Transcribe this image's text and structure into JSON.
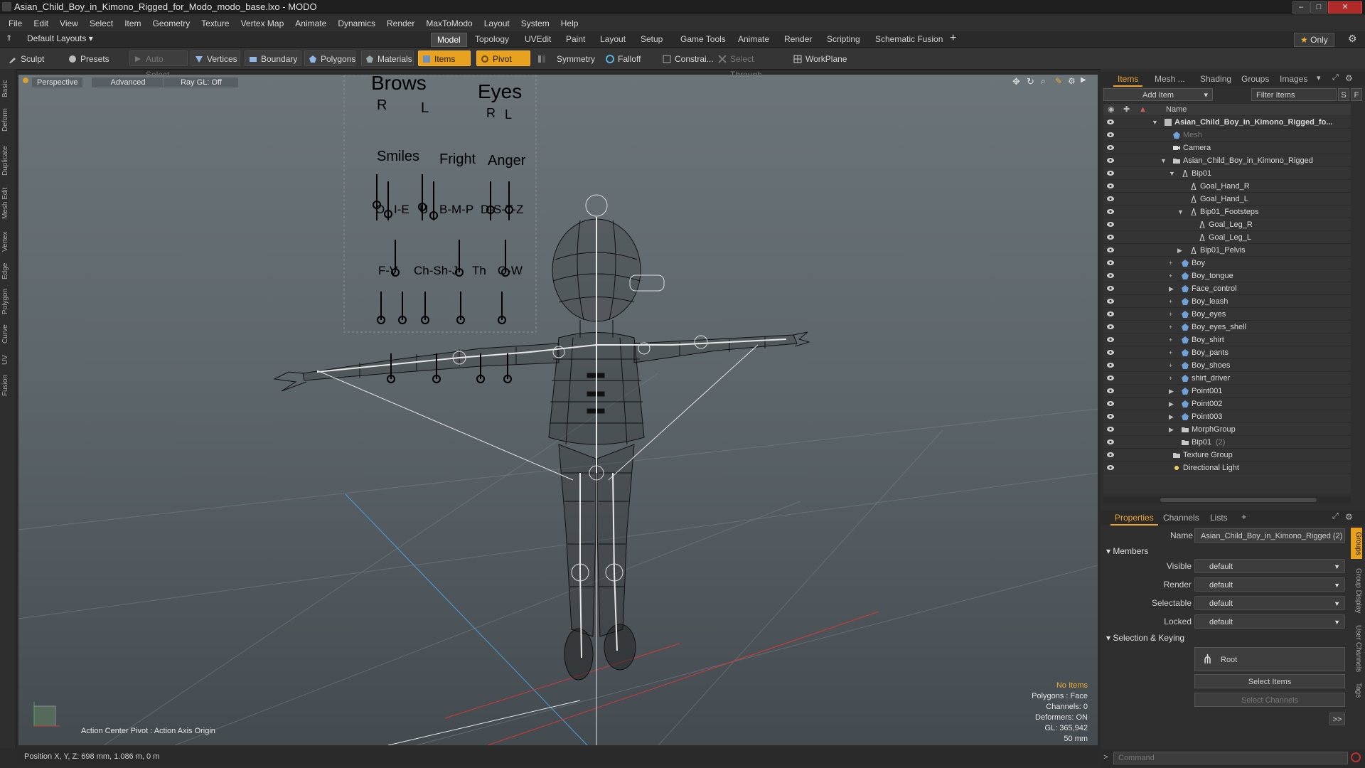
{
  "window": {
    "title": "Asian_Child_Boy_in_Kimono_Rigged_for_Modo_modo_base.lxo - MODO"
  },
  "menu": [
    "File",
    "Edit",
    "View",
    "Select",
    "Item",
    "Geometry",
    "Texture",
    "Vertex Map",
    "Animate",
    "Dynamics",
    "Render",
    "MaxToModo",
    "Layout",
    "System",
    "Help"
  ],
  "layout": {
    "preset": "Default Layouts",
    "tabs": [
      "Model",
      "Topology",
      "UVEdit",
      "Paint",
      "Layout",
      "Setup",
      "Game Tools",
      "Animate",
      "Render",
      "Scripting",
      "Schematic Fusion"
    ],
    "active_tab": "Model",
    "only_label": "Only"
  },
  "toolbar": {
    "sculpt": "Sculpt",
    "presets": "Presets",
    "auto_select": "Auto Select",
    "vertices": "Vertices",
    "boundary": "Boundary",
    "polygons": "Polygons",
    "materials": "Materials",
    "items": "Items",
    "pivot": "Pivot",
    "symmetry": "Symmetry",
    "falloff": "Falloff",
    "constraints": "Constrai...",
    "select_through": "Select Through",
    "workplane": "WorkPlane"
  },
  "left_tabs": [
    "Basic",
    "Deform",
    "Duplicate",
    "Mesh Edit",
    "Vertex",
    "Edge",
    "Polygon",
    "Curve",
    "UV",
    "Fusion"
  ],
  "viewport": {
    "perspective": "Perspective",
    "advanced": "Advanced",
    "raygl": "Ray GL: Off",
    "action_center": "Action Center Pivot : Action Axis Origin",
    "hud": {
      "no_items": "No Items",
      "polygons": "Polygons : Face",
      "channels": "Channels: 0",
      "deformers": "Deformers: ON",
      "gl": "GL: 365,942",
      "scale": "50 mm"
    },
    "face_board": {
      "brows": "Brows",
      "eyes": "Eyes",
      "r1": "R",
      "l1": "L",
      "r2": "R",
      "l2": "L",
      "smiles": "Smiles",
      "fright": "Fright",
      "anger": "Anger",
      "o": "O",
      "ie": "I-E",
      "u": "U",
      "bmp": "B-M-P",
      "dstz": "D-S-T-Z",
      "fv": "F-V",
      "chshj": "Ch-Sh-J",
      "th": "Th",
      "qw": "Q-W"
    }
  },
  "status": {
    "position": "Position X, Y, Z:   698 mm, 1.086 m, 0 m"
  },
  "items_panel": {
    "tabs": [
      "Items",
      "Mesh ...",
      "Shading",
      "Groups",
      "Images"
    ],
    "add_item": "Add Item",
    "filter": "Filter Items",
    "s_btn": "S",
    "f_btn": "F",
    "name_col": "Name",
    "tree": [
      {
        "label": "Asian_Child_Boy_in_Kimono_Rigged_fo...",
        "indent": 0,
        "arrow": "▼",
        "icon": "scene",
        "bold": true
      },
      {
        "label": "Mesh",
        "indent": 1,
        "arrow": "",
        "icon": "mesh",
        "dim": true
      },
      {
        "label": "Camera",
        "indent": 1,
        "arrow": "",
        "icon": "camera"
      },
      {
        "label": "Asian_Child_Boy_in_Kimono_Rigged",
        "indent": 1,
        "arrow": "▼",
        "icon": "group"
      },
      {
        "label": "Bip01",
        "indent": 2,
        "arrow": "▼",
        "icon": "bone"
      },
      {
        "label": "Goal_Hand_R",
        "indent": 3,
        "arrow": "",
        "icon": "bone"
      },
      {
        "label": "Goal_Hand_L",
        "indent": 3,
        "arrow": "",
        "icon": "bone"
      },
      {
        "label": "Bip01_Footsteps",
        "indent": 3,
        "arrow": "▼",
        "icon": "bone"
      },
      {
        "label": "Goal_Leg_R",
        "indent": 4,
        "arrow": "",
        "icon": "bone"
      },
      {
        "label": "Goal_Leg_L",
        "indent": 4,
        "arrow": "",
        "icon": "bone"
      },
      {
        "label": "Bip01_Pelvis",
        "indent": 3,
        "arrow": "▶",
        "icon": "bone"
      },
      {
        "label": "Boy",
        "indent": 2,
        "arrow": "+",
        "icon": "mesh"
      },
      {
        "label": "Boy_tongue",
        "indent": 2,
        "arrow": "+",
        "icon": "mesh"
      },
      {
        "label": "Face_control",
        "indent": 2,
        "arrow": "▶",
        "icon": "mesh"
      },
      {
        "label": "Boy_leash",
        "indent": 2,
        "arrow": "+",
        "icon": "mesh"
      },
      {
        "label": "Boy_eyes",
        "indent": 2,
        "arrow": "+",
        "icon": "mesh"
      },
      {
        "label": "Boy_eyes_shell",
        "indent": 2,
        "arrow": "+",
        "icon": "mesh"
      },
      {
        "label": "Boy_shirt",
        "indent": 2,
        "arrow": "+",
        "icon": "mesh"
      },
      {
        "label": "Boy_pants",
        "indent": 2,
        "arrow": "+",
        "icon": "mesh"
      },
      {
        "label": "Boy_shoes",
        "indent": 2,
        "arrow": "+",
        "icon": "mesh"
      },
      {
        "label": "shirt_driver",
        "indent": 2,
        "arrow": "+",
        "icon": "mesh"
      },
      {
        "label": "Point001",
        "indent": 2,
        "arrow": "▶ +",
        "icon": "mesh"
      },
      {
        "label": "Point002",
        "indent": 2,
        "arrow": "▶ +",
        "icon": "mesh"
      },
      {
        "label": "Point003",
        "indent": 2,
        "arrow": "▶ +",
        "icon": "mesh"
      },
      {
        "label": "MorphGroup",
        "indent": 2,
        "arrow": "▶",
        "icon": "group"
      },
      {
        "label": "Bip01",
        "suffix": "(2)",
        "indent": 2,
        "arrow": "",
        "icon": "group"
      },
      {
        "label": "Texture Group",
        "indent": 1,
        "arrow": "",
        "icon": "group"
      },
      {
        "label": "Directional Light",
        "indent": 1,
        "arrow": "",
        "icon": "light"
      }
    ]
  },
  "properties": {
    "tabs": [
      "Properties",
      "Channels",
      "Lists"
    ],
    "name_label": "Name",
    "name_value": "Asian_Child_Boy_in_Kimono_Rigged (2)",
    "members": "Members",
    "rows": [
      {
        "label": "Visible",
        "value": "default"
      },
      {
        "label": "Render",
        "value": "default"
      },
      {
        "label": "Selectable",
        "value": "default"
      },
      {
        "label": "Locked",
        "value": "default"
      }
    ],
    "sel_keying": "Selection & Keying",
    "root": "Root",
    "select_items": "Select Items",
    "select_channels": "Select Channels",
    "more": ">>",
    "side_tabs": [
      "Groups",
      "Group Display",
      "User Channels",
      "Tags"
    ]
  },
  "command": {
    "placeholder": "Command"
  }
}
